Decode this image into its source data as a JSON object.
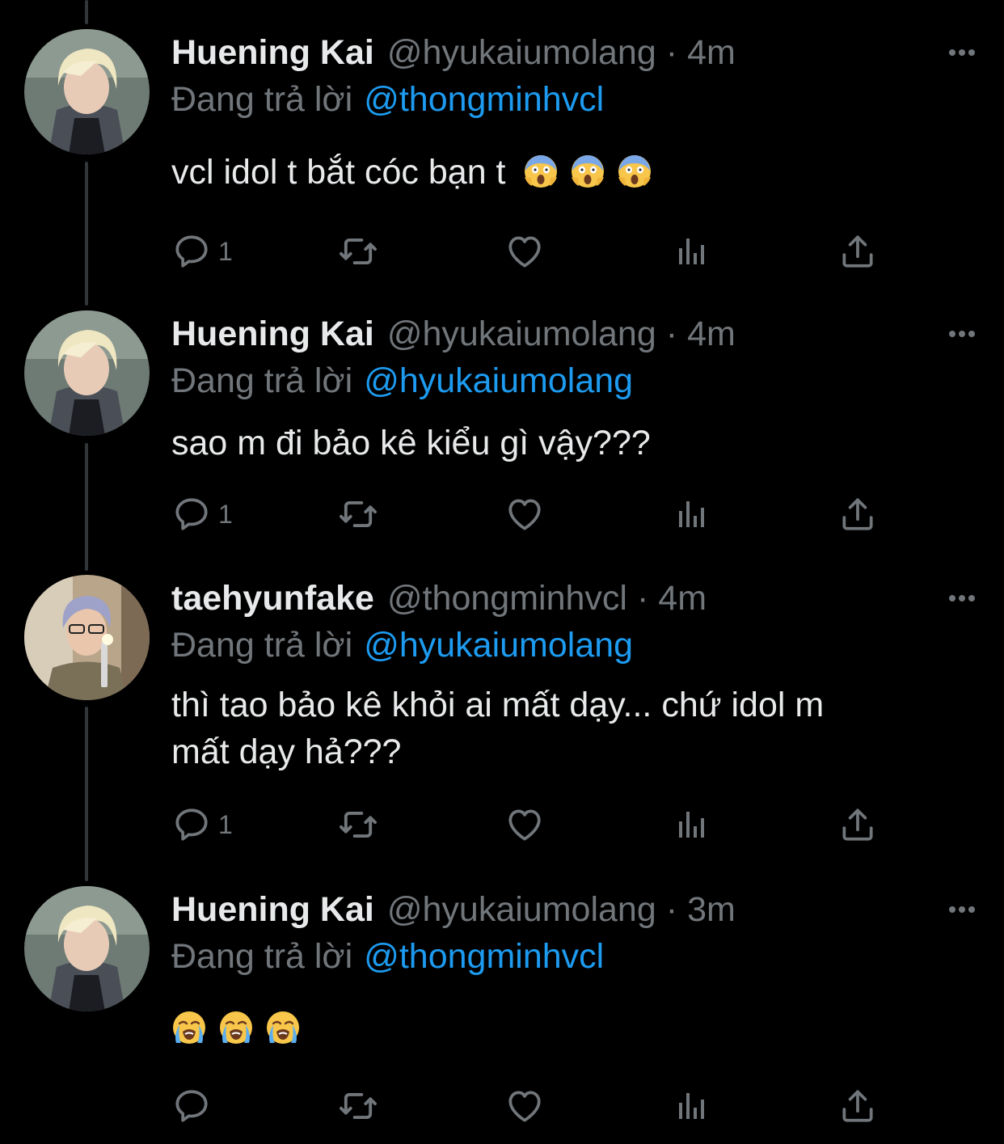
{
  "colors": {
    "background": "#000000",
    "text": "#e7e9ea",
    "muted": "#71767b",
    "link": "#1d9bf0",
    "thread_line": "#333639"
  },
  "tweets": [
    {
      "display_name": "Huening Kai",
      "handle": "@hyukaiumolang",
      "separator": "·",
      "time": "4m",
      "reply_prefix": "Đang trả lời",
      "reply_to": "@thongminhvcl",
      "text": "vcl idol t bắt cóc bạn t",
      "emojis": [
        "face-screaming-in-fear-emoji",
        "face-screaming-in-fear-emoji",
        "face-screaming-in-fear-emoji"
      ],
      "reply_count": "1"
    },
    {
      "display_name": "Huening Kai",
      "handle": "@hyukaiumolang",
      "separator": "·",
      "time": "4m",
      "reply_prefix": "Đang trả lời",
      "reply_to": "@hyukaiumolang",
      "text": "sao m đi bảo kê kiểu gì vậy???",
      "reply_count": "1"
    },
    {
      "display_name": "taehyunfake",
      "handle": "@thongminhvcl",
      "separator": "·",
      "time": "4m",
      "reply_prefix": "Đang trả lời",
      "reply_to": "@hyukaiumolang",
      "text_line1": "thì tao bảo kê khỏi ai mất dạy... chứ idol m",
      "text_line2": "mất dạy hả???",
      "reply_count": "1"
    },
    {
      "display_name": "Huening Kai",
      "handle": "@hyukaiumolang",
      "separator": "·",
      "time": "3m",
      "reply_prefix": "Đang trả lời",
      "reply_to": "@thongminhvcl",
      "emojis": [
        "loudly-crying-face-emoji",
        "loudly-crying-face-emoji",
        "loudly-crying-face-emoji"
      ],
      "reply_count": ""
    }
  ]
}
